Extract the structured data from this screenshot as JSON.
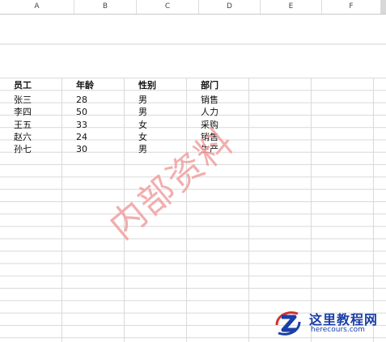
{
  "columns": [
    "A",
    "B",
    "C",
    "D",
    "E",
    "F"
  ],
  "table": {
    "headers": [
      "员工",
      "年龄",
      "性别",
      "部门"
    ],
    "rows": [
      [
        "张三",
        "28",
        "男",
        "销售"
      ],
      [
        "李四",
        "50",
        "男",
        "人力"
      ],
      [
        "王五",
        "33",
        "女",
        "采购"
      ],
      [
        "赵六",
        "24",
        "女",
        "销售"
      ],
      [
        "孙七",
        "30",
        "男",
        "生产"
      ]
    ]
  },
  "watermark": {
    "text": "内部资料",
    "color": "#f0a0a0"
  },
  "logo": {
    "title": "这里教程网",
    "url": "herecours.com",
    "color": "#1a3fa8",
    "accent": "#d32f2f"
  }
}
